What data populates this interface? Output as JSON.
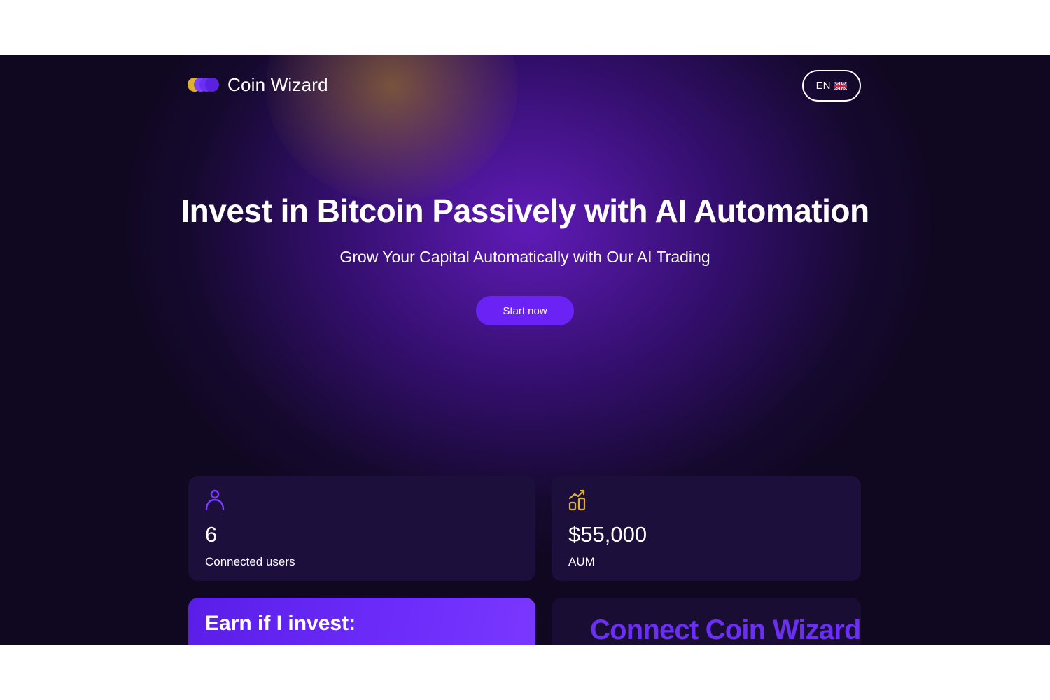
{
  "brand": {
    "name": "Coin Wizard",
    "logo_icon": "coin-stack-logo-icon",
    "colors": {
      "gold": "#e0b030",
      "purple": "#6a22f5",
      "background": "#0f0820",
      "card": "#1c0f3c"
    }
  },
  "header": {
    "language_label": "EN",
    "language_flag_icon": "uk-flag-icon"
  },
  "hero": {
    "title": "Invest in Bitcoin Passively with AI Automation",
    "subtitle": "Grow Your Capital Automatically with Our AI Trading",
    "cta_label": "Start now"
  },
  "stats": [
    {
      "icon": "user-icon",
      "value": "6",
      "label": "Connected users"
    },
    {
      "icon": "bar-chart-icon",
      "value": "$55,000",
      "label": "AUM"
    }
  ],
  "earn_card": {
    "title": "Earn if I invest:"
  },
  "connect_card": {
    "title": "Connect Coin Wizard"
  }
}
